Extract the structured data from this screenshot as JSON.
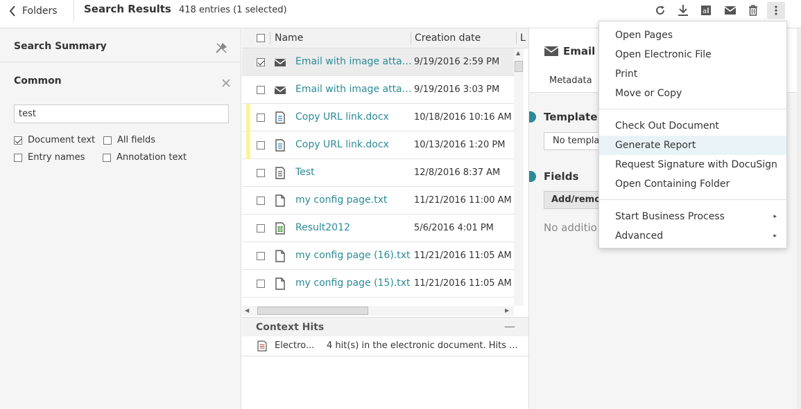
{
  "topbar": {
    "back_label": "Folders",
    "title": "Search Results",
    "count": "418 entries (1 selected)",
    "tools": [
      "refresh-icon",
      "download-icon",
      "ocr-text-icon",
      "email-icon",
      "trash-icon",
      "more-vertical-icon"
    ]
  },
  "search_summary": {
    "title": "Search Summary",
    "common_title": "Common",
    "query": "test",
    "options": [
      {
        "label": "Document text",
        "checked": true
      },
      {
        "label": "All fields",
        "checked": false
      },
      {
        "label": "Entry names",
        "checked": false
      },
      {
        "label": "Annotation text",
        "checked": false
      }
    ]
  },
  "results": {
    "columns": [
      "Name",
      "Creation date",
      "L"
    ],
    "rows": [
      {
        "name": "Email with image attachment",
        "date": "9/19/2016 2:59 PM",
        "icon": "email-icon",
        "selected": true,
        "marked": false
      },
      {
        "name": "Email with image attachment",
        "date": "9/19/2016 3:03 PM",
        "icon": "email-icon",
        "selected": false,
        "marked": false
      },
      {
        "name": "Copy URL link.docx",
        "date": "10/18/2016 10:16 AM",
        "icon": "document-icon",
        "selected": false,
        "marked": true
      },
      {
        "name": "Copy URL link.docx",
        "date": "10/13/2016 1:20 PM",
        "icon": "document-icon",
        "selected": false,
        "marked": true
      },
      {
        "name": "Test",
        "date": "12/8/2016 8:37 AM",
        "icon": "document-icon",
        "selected": false,
        "marked": false
      },
      {
        "name": "my config page.txt",
        "date": "11/21/2016 11:00 AM",
        "icon": "file-icon",
        "selected": false,
        "marked": false
      },
      {
        "name": "Result2012",
        "date": "5/6/2016 4:01 PM",
        "icon": "spreadsheet-icon",
        "selected": false,
        "marked": false
      },
      {
        "name": "my config page (16).txt",
        "date": "11/21/2016 11:05 AM",
        "icon": "file-icon",
        "selected": false,
        "marked": false
      },
      {
        "name": "my config page (15).txt",
        "date": "11/21/2016 11:05 AM",
        "icon": "file-icon",
        "selected": false,
        "marked": false
      }
    ]
  },
  "context_hits": {
    "title": "Context Hits",
    "minimize": "—",
    "rows": [
      {
        "source": "Electro...",
        "text": "4 hit(s) in the electronic document. Hits ..."
      }
    ]
  },
  "metadata": {
    "doc_title": "Email w",
    "tab": "Metadata",
    "template_title": "Template",
    "template_value": "No templa",
    "fields_title": "Fields",
    "add_button": "Add/remo",
    "no_fields": "No additio"
  },
  "menu": {
    "groups": [
      [
        "Open Pages",
        "Open Electronic File",
        "Print",
        "Move or Copy"
      ],
      [
        "Check Out Document",
        "Generate Report",
        "Request Signature with DocuSign",
        "Open Containing Folder"
      ],
      [
        "Start Business Process",
        "Advanced"
      ]
    ],
    "highlighted": "Generate Report",
    "submenu_items": [
      "Start Business Process",
      "Advanced"
    ],
    "submenu_arrow": "▸"
  },
  "colors": {
    "accent": "#2b8a96",
    "marker": "#fbf49a",
    "menu_highlight": "#e9f3f7"
  }
}
